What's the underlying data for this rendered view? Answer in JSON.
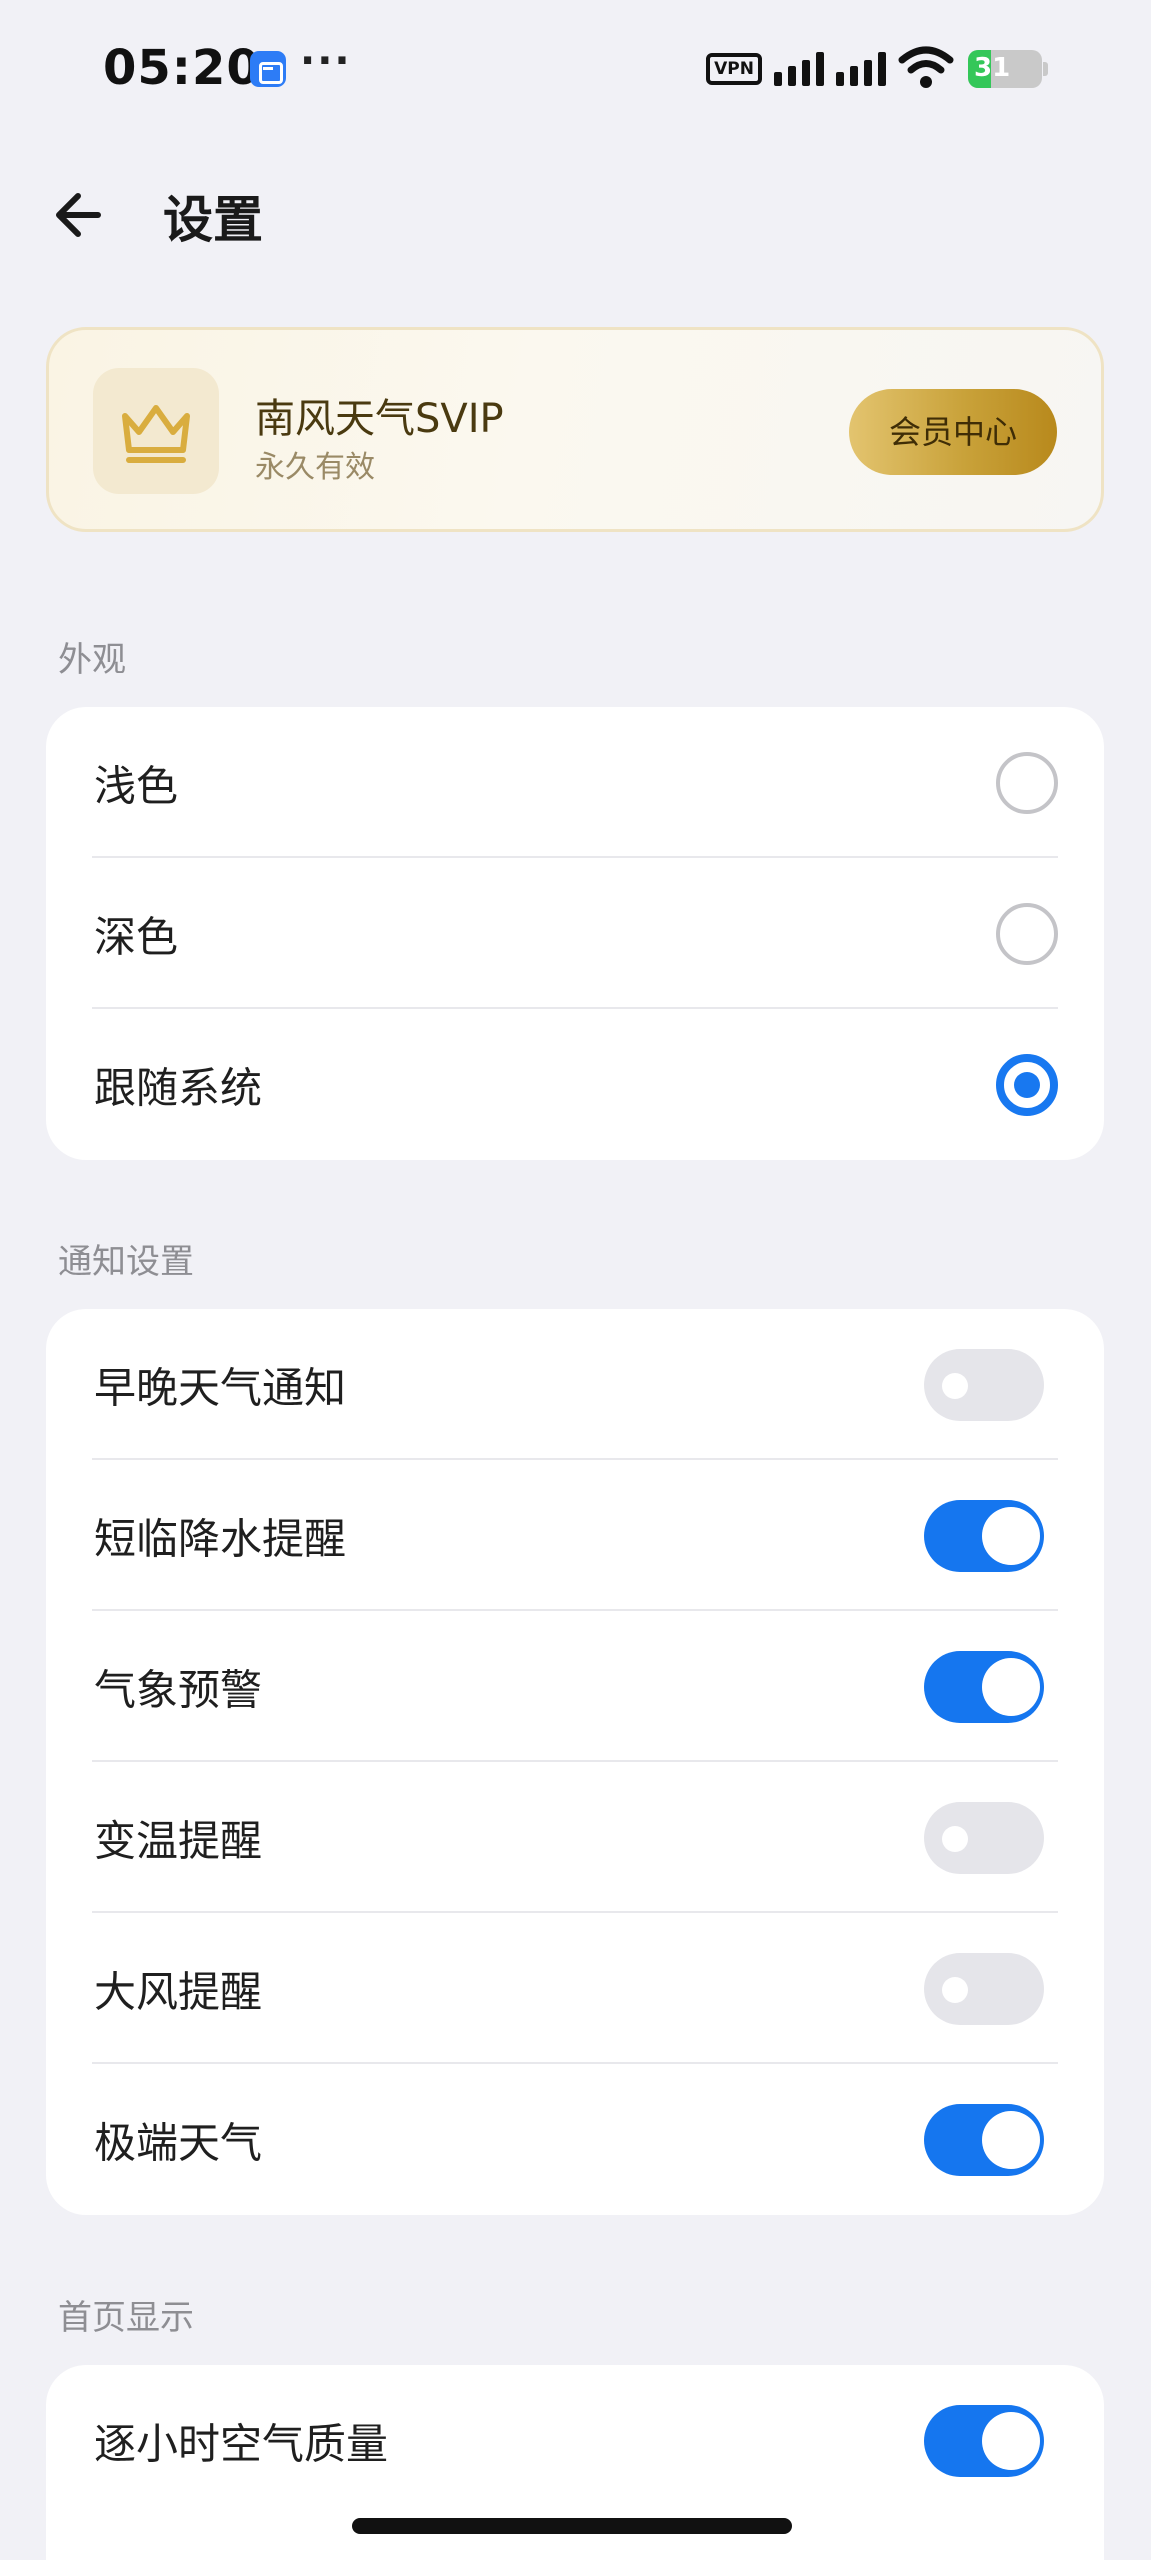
{
  "status_bar": {
    "time": "05:20",
    "more": "···",
    "vpn": "VPN",
    "battery": "31",
    "battery_level": 0.31,
    "colors": {
      "battery_fill": "#34c759"
    },
    "icons": [
      "app-notification-icon",
      "more-icon",
      "vpn-icon",
      "signal-icon",
      "wifi-icon",
      "battery-icon"
    ]
  },
  "header": {
    "title": "设置",
    "back_icon": "arrow-left-icon"
  },
  "vip": {
    "name": "南风天气SVIP",
    "validity": "永久有效",
    "center_button": "会员中心",
    "icon": "crown-icon",
    "colors": {
      "crown": "#d9ad3f",
      "button": "#c9a23a"
    }
  },
  "appearance": {
    "section_title": "外观",
    "options": [
      {
        "label": "浅色",
        "selected": false
      },
      {
        "label": "深色",
        "selected": false
      },
      {
        "label": "跟随系统",
        "selected": true
      }
    ],
    "colors": {
      "accent": "#1878f0"
    }
  },
  "notifications": {
    "section_title": "通知设置",
    "items": [
      {
        "label": "早晚天气通知",
        "enabled": false
      },
      {
        "label": "短临降水提醒",
        "enabled": true
      },
      {
        "label": "气象预警",
        "enabled": true
      },
      {
        "label": "变温提醒",
        "enabled": false
      },
      {
        "label": "大风提醒",
        "enabled": false
      },
      {
        "label": "极端天气",
        "enabled": true
      }
    ],
    "colors": {
      "toggle_on": "#1576ef",
      "toggle_off": "#e5e5ea"
    }
  },
  "home_display": {
    "section_title": "首页显示",
    "items": [
      {
        "label": "逐小时空气质量",
        "enabled": true
      }
    ]
  }
}
